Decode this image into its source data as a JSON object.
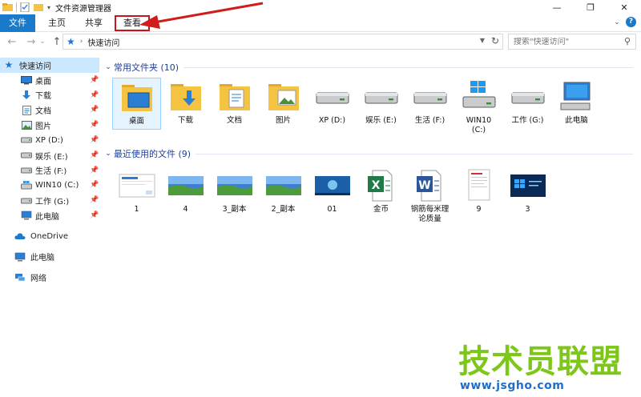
{
  "window": {
    "title": "文件资源管理器",
    "minimize": "—",
    "maximize": "❐",
    "close": "✕"
  },
  "ribbon": {
    "tabs": [
      "文件",
      "主页",
      "共享",
      "查看"
    ],
    "collapse": "⌄",
    "help": "?"
  },
  "address": {
    "back": "←",
    "forward": "→",
    "recent": "⌄",
    "up": "↑",
    "path": "快速访问",
    "search_placeholder": "搜索\"快速访问\""
  },
  "sidebar": {
    "quick_access": "快速访问",
    "quick_items": [
      {
        "label": "桌面",
        "icon": "desktop-icon"
      },
      {
        "label": "下载",
        "icon": "download-icon"
      },
      {
        "label": "文档",
        "icon": "document-icon"
      },
      {
        "label": "图片",
        "icon": "picture-icon"
      },
      {
        "label": "XP (D:)",
        "icon": "drive-icon"
      },
      {
        "label": "娱乐 (E:)",
        "icon": "drive-icon"
      },
      {
        "label": "生活 (F:)",
        "icon": "drive-icon"
      },
      {
        "label": "WIN10 (C:)",
        "icon": "windows-drive-icon"
      },
      {
        "label": "工作 (G:)",
        "icon": "drive-icon"
      },
      {
        "label": "此电脑",
        "icon": "computer-icon"
      }
    ],
    "onedrive": "OneDrive",
    "this_pc": "此电脑",
    "network": "网络"
  },
  "frequent": {
    "header": "常用文件夹 (10)",
    "items": [
      {
        "label": "桌面",
        "icon": "desktop-folder-icon"
      },
      {
        "label": "下载",
        "icon": "download-folder-icon"
      },
      {
        "label": "文档",
        "icon": "documents-folder-icon"
      },
      {
        "label": "图片",
        "icon": "pictures-folder-icon"
      },
      {
        "label": "XP (D:)",
        "icon": "drive-icon"
      },
      {
        "label": "娱乐 (E:)",
        "icon": "drive-icon"
      },
      {
        "label": "生活 (F:)",
        "icon": "drive-icon"
      },
      {
        "label": "WIN10\n(C:)",
        "icon": "windows-drive-icon"
      },
      {
        "label": "工作 (G:)",
        "icon": "drive-icon"
      },
      {
        "label": "此电脑",
        "icon": "computer-icon"
      }
    ]
  },
  "recent": {
    "header": "最近使用的文件 (9)",
    "items": [
      {
        "label": "1",
        "icon": "screenshot-thumbnail-icon"
      },
      {
        "label": "4",
        "icon": "landscape-thumbnail-icon"
      },
      {
        "label": "3_副本",
        "icon": "landscape-thumbnail-icon"
      },
      {
        "label": "2_副本",
        "icon": "landscape-thumbnail-icon"
      },
      {
        "label": "01",
        "icon": "win7-thumbnail-icon"
      },
      {
        "label": "金币",
        "icon": "excel-file-icon"
      },
      {
        "label": "钢筋每米理\n论质量",
        "icon": "word-file-icon"
      },
      {
        "label": "9",
        "icon": "document-thumbnail-icon"
      },
      {
        "label": "3",
        "icon": "win8-thumbnail-icon"
      }
    ]
  },
  "watermark": {
    "title": "技术员联盟",
    "url": "www.jsgho.com"
  },
  "colors": {
    "accent": "#1979ca",
    "highlight": "#c5161d",
    "header": "#1f3f99",
    "watermark_green": "#7ec71a",
    "watermark_blue": "#1e6fc9"
  }
}
